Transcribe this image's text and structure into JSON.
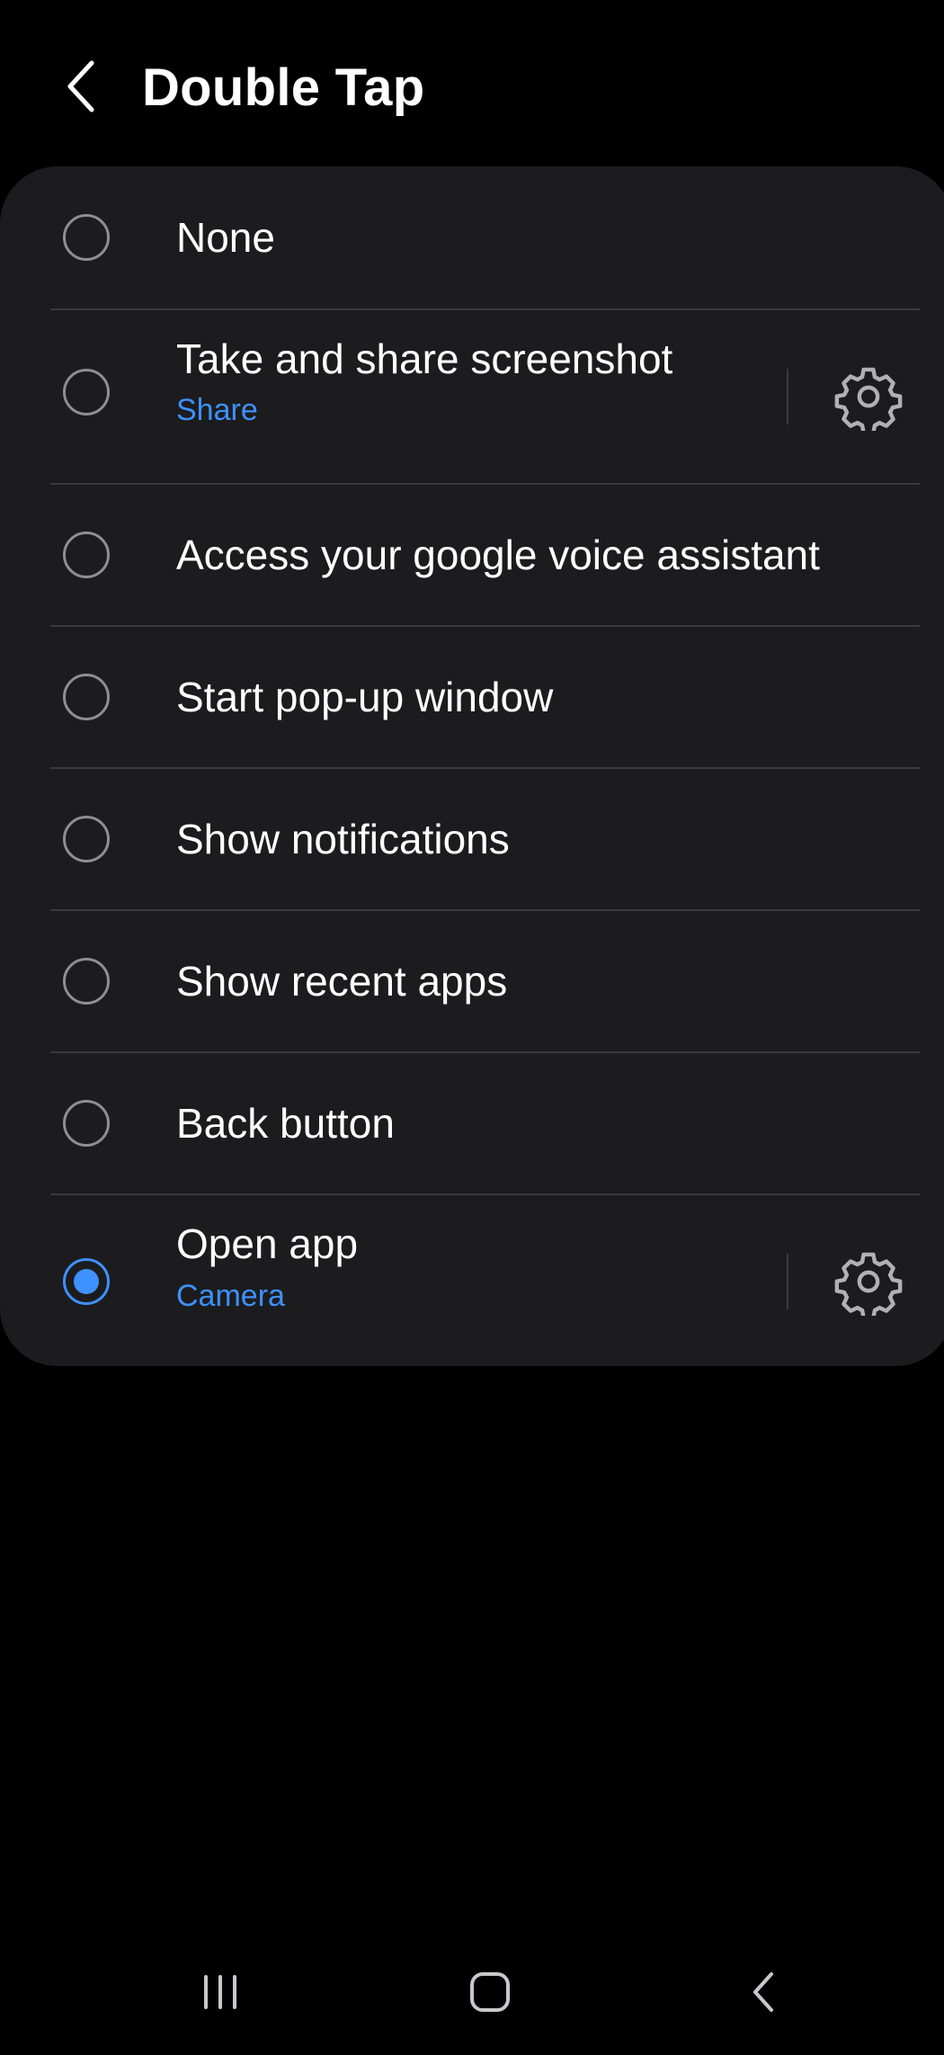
{
  "header": {
    "title": "Double Tap",
    "back_icon": "chevron-left-icon"
  },
  "options": [
    {
      "id": "none",
      "label": "None",
      "selected": false
    },
    {
      "id": "screenshot",
      "label": "Take and share screenshot",
      "sublabel": "Share",
      "selected": false,
      "has_settings": true
    },
    {
      "id": "voice-assistant",
      "label": "Access your google voice assistant",
      "selected": false
    },
    {
      "id": "popup-window",
      "label": "Start pop-up window",
      "selected": false
    },
    {
      "id": "notifications",
      "label": "Show notifications",
      "selected": false
    },
    {
      "id": "recent-apps",
      "label": "Show recent apps",
      "selected": false
    },
    {
      "id": "back-button",
      "label": "Back button",
      "selected": false
    },
    {
      "id": "open-app",
      "label": "Open app",
      "sublabel": "Camera",
      "selected": true,
      "has_settings": true
    }
  ],
  "navbar": {
    "recents_icon": "recents-icon",
    "home_icon": "home-icon",
    "back_icon": "back-icon"
  },
  "colors": {
    "background": "#000000",
    "card": "#1c1c1e",
    "accent": "#3e91ff",
    "radio_border": "#8e8e93",
    "divider": "#3a3a3c",
    "text": "#ffffff"
  }
}
